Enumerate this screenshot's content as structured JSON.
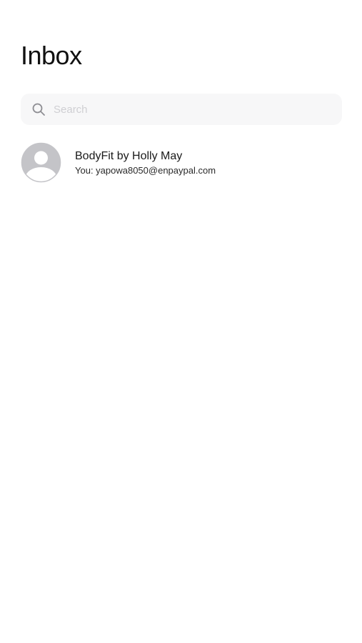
{
  "header": {
    "title": "Inbox"
  },
  "search": {
    "placeholder": "Search",
    "value": "",
    "icon": "search-icon"
  },
  "conversations": [
    {
      "name": "BodyFit by Holly May",
      "preview": "You: yapowa8050@enpaypal.com",
      "avatar_icon": "default-user-avatar-icon"
    }
  ],
  "colors": {
    "background": "#ffffff",
    "search_background": "#f7f7f8",
    "avatar_gray": "#c4c4c8"
  }
}
